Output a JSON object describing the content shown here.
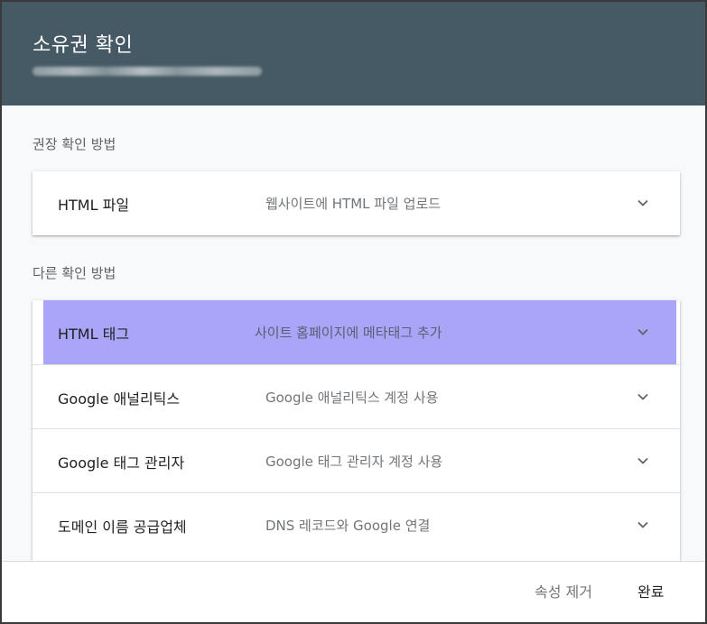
{
  "dialog": {
    "title": "소유권 확인"
  },
  "recommended": {
    "label": "권장 확인 방법",
    "items": [
      {
        "title": "HTML 파일",
        "desc": "웹사이트에 HTML 파일 업로드"
      }
    ]
  },
  "other": {
    "label": "다른 확인 방법",
    "items": [
      {
        "title": "HTML 태그",
        "desc": "사이트 홈페이지에 메타태그 추가"
      },
      {
        "title": "Google 애널리틱스",
        "desc": "Google 애널리틱스 계정 사용"
      },
      {
        "title": "Google 태그 관리자",
        "desc": "Google 태그 관리자 계정 사용"
      },
      {
        "title": "도메인 이름 공급업체",
        "desc": "DNS 레코드와 Google 연결"
      }
    ]
  },
  "footer": {
    "remove_label": "속성 제거",
    "done_label": "완료"
  },
  "colors": {
    "header_bg": "#455a64",
    "highlight_bg": "#a9a6f7"
  },
  "icons": {
    "expand": "chevron-down-icon"
  }
}
